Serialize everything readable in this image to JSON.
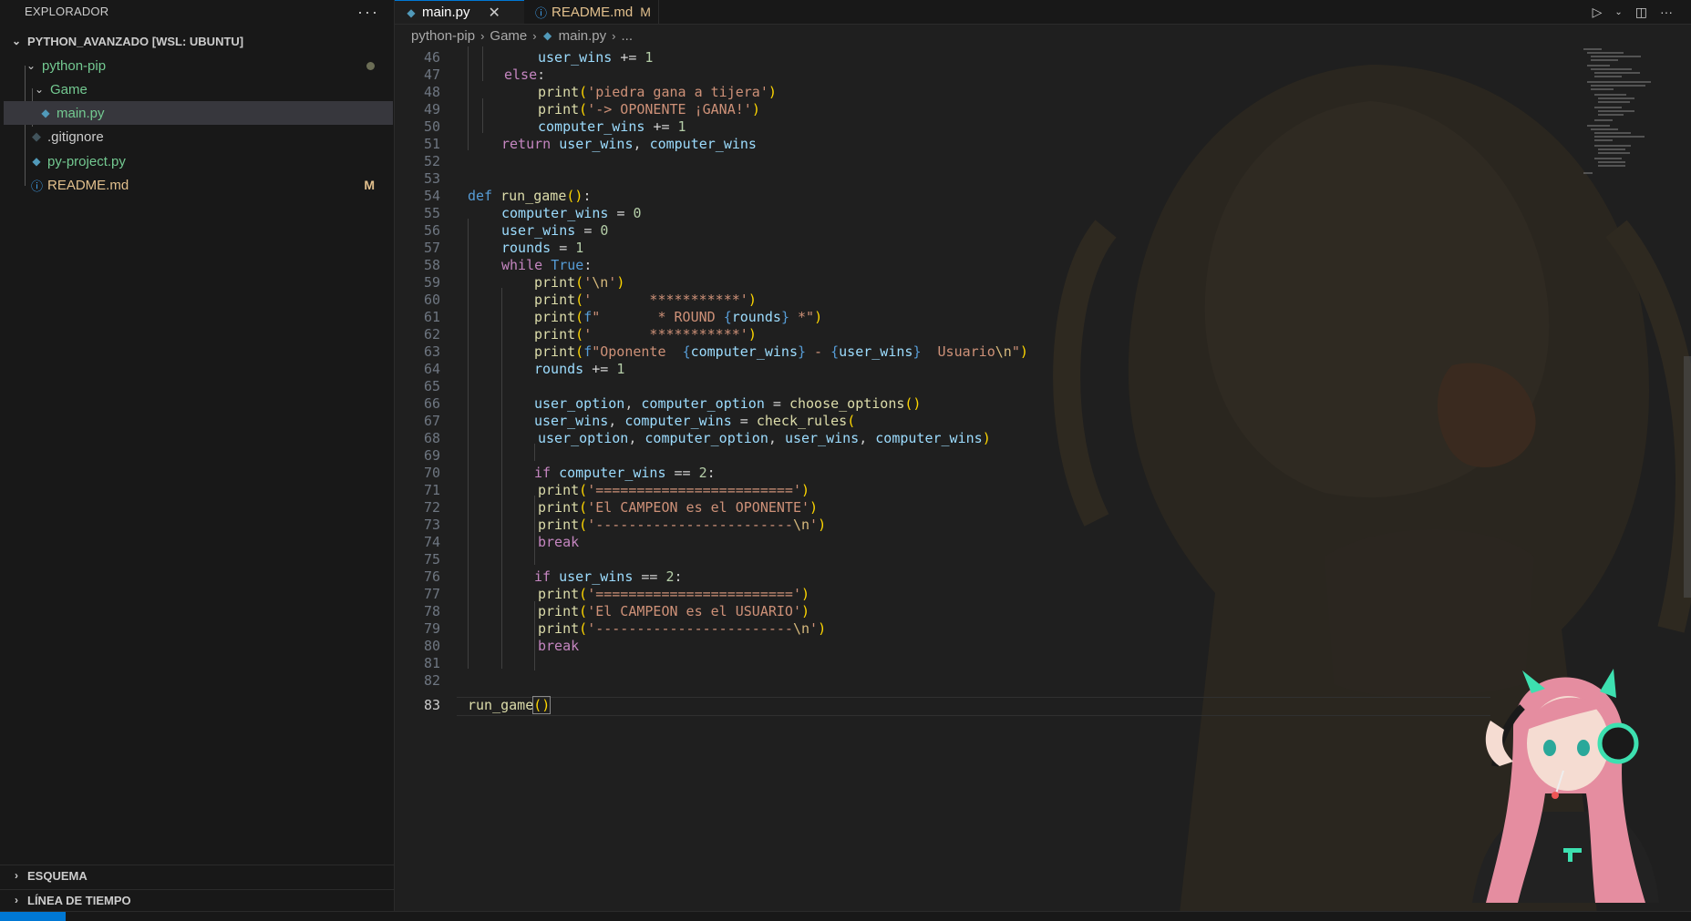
{
  "sidebar": {
    "title": "EXPLORADOR",
    "more_icon": "ellipsis-icon",
    "workspace": "PYTHON_AVANZADO [WSL: UBUNTU]",
    "items": [
      {
        "label": "python-pip",
        "type": "folder",
        "status": "dot"
      },
      {
        "label": "Game",
        "type": "folder"
      },
      {
        "label": "main.py",
        "type": "python-file",
        "selected": true
      },
      {
        "label": ".gitignore",
        "type": "git-file"
      },
      {
        "label": "py-project.py",
        "type": "python-file"
      },
      {
        "label": "README.md",
        "type": "info-file",
        "badge": "M"
      }
    ],
    "outline": "ESQUEMA",
    "timeline": "LÍNEA DE TIEMPO"
  },
  "tabs": [
    {
      "label": "main.py",
      "active": true,
      "icon": "python-icon"
    },
    {
      "label": "README.md",
      "active": false,
      "icon": "info-icon",
      "badge": "M"
    }
  ],
  "breadcrumb": [
    "python-pip",
    "Game",
    "main.py",
    "..."
  ],
  "editor": {
    "current_line": "83",
    "line_numbers": [
      "46",
      "47",
      "48",
      "49",
      "50",
      "51",
      "52",
      "53",
      "54",
      "55",
      "56",
      "57",
      "58",
      "59",
      "60",
      "61",
      "62",
      "63",
      "64",
      "65",
      "66",
      "67",
      "68",
      "69",
      "70",
      "71",
      "72",
      "73",
      "74",
      "75",
      "76",
      "77",
      "78",
      "79",
      "80",
      "81",
      "82",
      "83"
    ]
  },
  "colors": {
    "accent": "#0078d4",
    "modified": "#e2c08d",
    "keyword": "#c586c0",
    "string": "#ce9178",
    "function": "#dcdcaa",
    "variable": "#9cdcfe"
  }
}
